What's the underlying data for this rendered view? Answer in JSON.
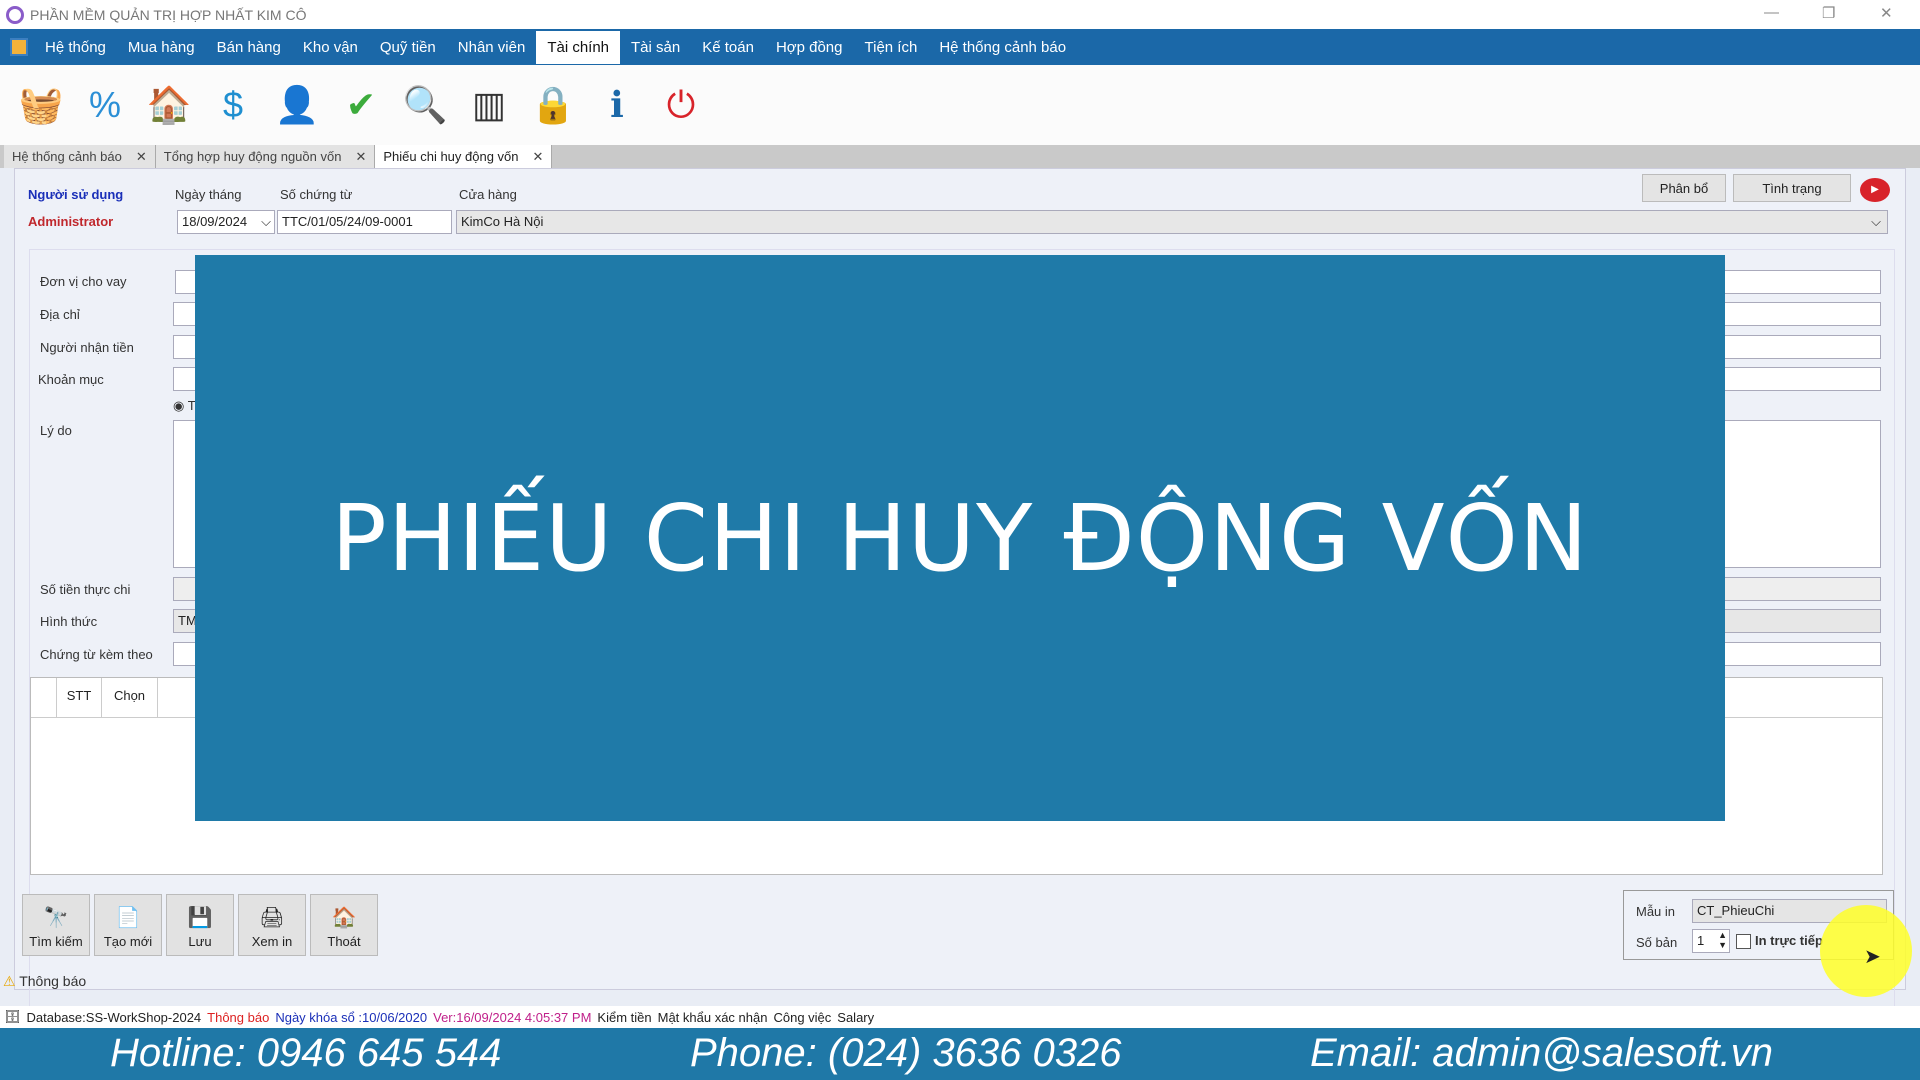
{
  "window": {
    "title": "PHẦN MỀM QUẢN TRỊ HỢP NHẤT KIM CÔ"
  },
  "menu": [
    "Hệ thống",
    "Mua hàng",
    "Bán hàng",
    "Kho vận",
    "Quỹ tiền",
    "Nhân viên",
    "Tài chính",
    "Tài sản",
    "Kế toán",
    "Hợp đồng",
    "Tiện ích",
    "Hệ thống cảnh báo"
  ],
  "menu_active": "Tài chính",
  "toolbar_icons": [
    "basket-icon",
    "discount-icon",
    "warehouse-icon",
    "money-book-icon",
    "user-info-icon",
    "checklist-icon",
    "search-document-icon",
    "barcode-icon",
    "lock-icon",
    "info-book-icon",
    "power-icon"
  ],
  "tabs": [
    {
      "label": "Hệ thống cảnh báo"
    },
    {
      "label": "Tổng hợp huy động nguồn vốn"
    },
    {
      "label": "Phiếu chi huy động vốn",
      "active": true
    }
  ],
  "header": {
    "user_label": "Người sử dụng",
    "user_value": "Administrator",
    "date_label": "Ngày tháng",
    "date_value": "18/09/2024",
    "doc_label": "Số chứng từ",
    "doc_value": "TTC/01/05/24/09-0001",
    "store_label": "Cửa hàng",
    "store_value": "KimCo Hà Nội",
    "allocate_button": "Phân bổ",
    "status_button": "Tình trạng"
  },
  "fields": {
    "lender": "Đơn vị cho vay",
    "address": "Địa chỉ",
    "receiver": "Người nhận tiền",
    "item": "Khoản mục",
    "radio_partial": "Tr",
    "reason": "Lý do",
    "amount": "Số tiền thực chi",
    "method": "Hình thức",
    "method_value": "TM",
    "attachments": "Chứng từ kèm theo"
  },
  "grid": {
    "columns": [
      "STT",
      "Chọn"
    ]
  },
  "overlay": {
    "title": "PHIẾU CHI HUY ĐỘNG VỐN"
  },
  "actions": [
    "Tìm kiếm",
    "Tạo mới",
    "Lưu",
    "Xem in",
    "Thoát"
  ],
  "print": {
    "template_label": "Mẫu in",
    "template_value": "CT_PhieuChi",
    "copies_label": "Số bản",
    "copies_value": "1",
    "direct_label": "In trực tiếp",
    "direct_checked": false
  },
  "notice": "Thông báo",
  "status": {
    "database": "Database:SS-WorkShop-2024",
    "notice": "Thông báo",
    "lock_date": "Ngày khóa sổ :10/06/2020",
    "version": "Ver:16/09/2024 4:05:37 PM",
    "check_money": "Kiểm tiền",
    "password": "Mật khẩu xác nhận",
    "job": "Công việc",
    "salary": "Salary"
  },
  "footer": {
    "hotline": "Hotline: 0946 645 544",
    "phone": "Phone: (024) 3636 0326",
    "email": "Email: admin@salesoft.vn"
  },
  "colors": {
    "menu": "#1b68a8",
    "overlay": "#1f7aa8",
    "footer": "#1f78a7",
    "user_value": "#c0282d",
    "user_label": "#1a2fb8"
  }
}
